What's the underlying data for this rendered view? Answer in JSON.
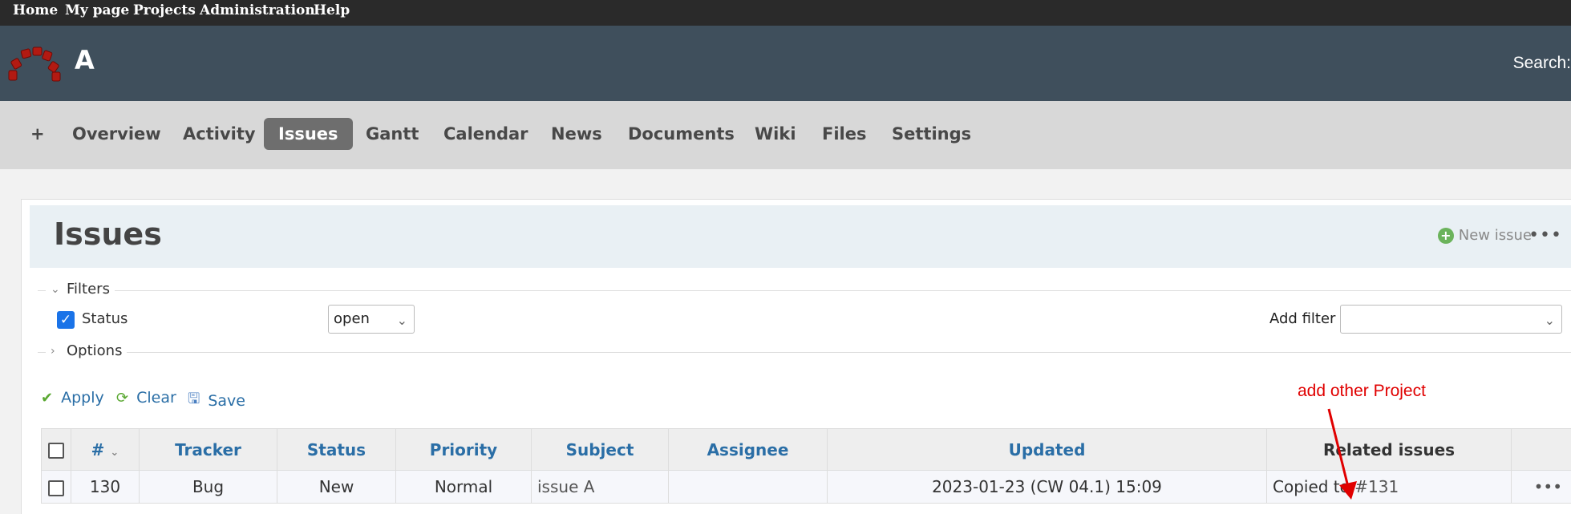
{
  "top_menu": {
    "items": [
      "Home",
      "My page",
      "Projects",
      "Administration",
      "Help"
    ]
  },
  "header": {
    "project_title": "A",
    "search_label": "Search:"
  },
  "main_menu": {
    "plus": "+",
    "tabs": [
      "Overview",
      "Activity",
      "Issues",
      "Gantt",
      "Calendar",
      "News",
      "Documents",
      "Wiki",
      "Files",
      "Settings"
    ],
    "selected": "Issues"
  },
  "content": {
    "title": "Issues",
    "new_issue": "New issue",
    "more": "•••"
  },
  "filters": {
    "legend": "Filters",
    "status_label": "Status",
    "status_value": "open",
    "add_filter_label": "Add filter",
    "add_filter_value": ""
  },
  "options": {
    "legend": "Options"
  },
  "actions": {
    "apply": "Apply",
    "clear": "Clear",
    "save": "Save"
  },
  "table": {
    "headers": [
      "#",
      "Tracker",
      "Status",
      "Priority",
      "Subject",
      "Assignee",
      "Updated",
      "Related issues"
    ],
    "rows": [
      {
        "id": "130",
        "tracker": "Bug",
        "status": "New",
        "priority": "Normal",
        "subject": "issue A",
        "assignee": "",
        "updated": "2023-01-23 (CW 04.1) 15:09",
        "related_prefix": "Copied to",
        "related_link": "#131",
        "more": "•••"
      }
    ]
  },
  "annotation": {
    "text": "add other Project",
    "color": "#e00000"
  },
  "colors": {
    "header_bg": "#3f4f5c",
    "link": "#2a6ea6",
    "tab_selected": "#6e6e6e"
  }
}
